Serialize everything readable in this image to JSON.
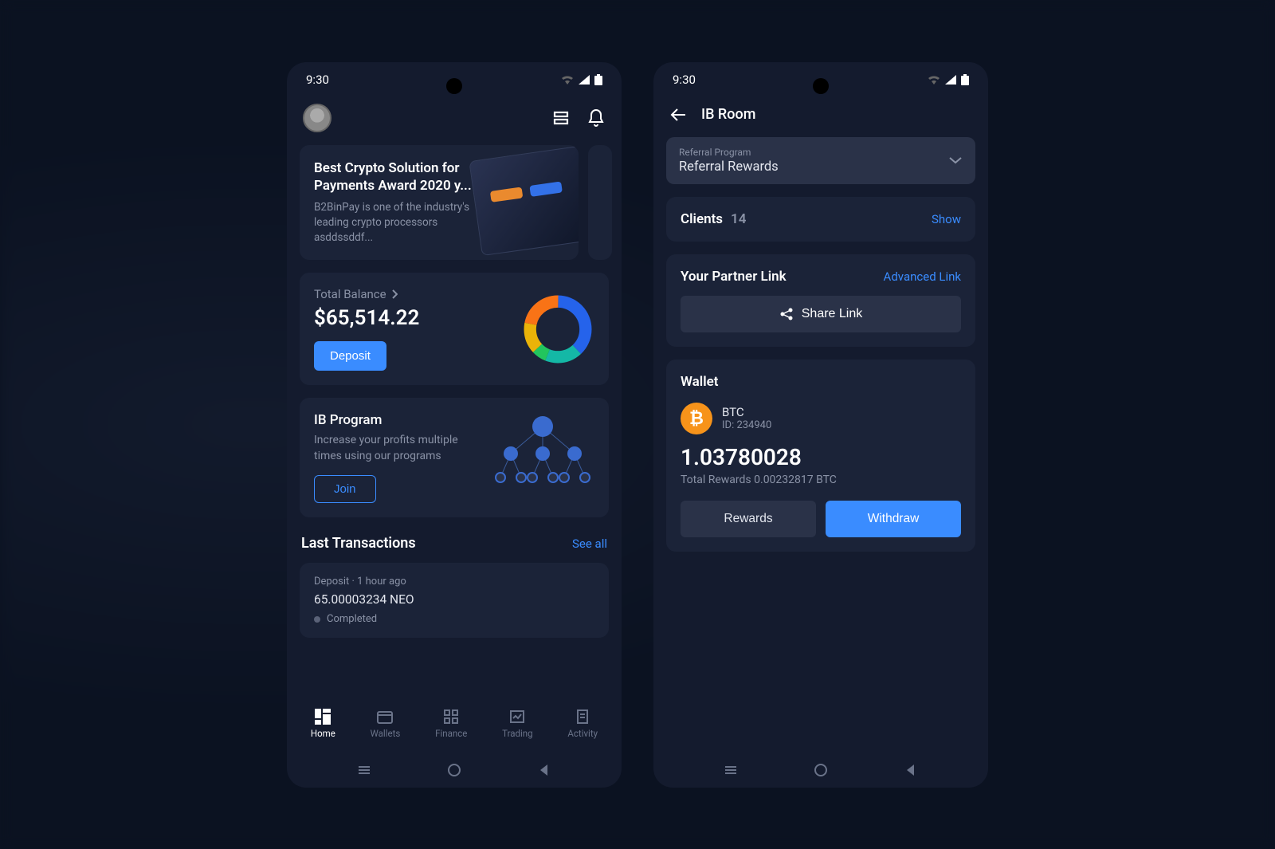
{
  "status_time": "9:30",
  "phone1": {
    "news": {
      "title": "Best Crypto Solution for Payments Award 2020 y...",
      "desc": "B2BinPay is one of the industry's leading crypto processors asddssddf..."
    },
    "balance": {
      "label": "Total Balance",
      "amount": "$65,514.22",
      "deposit_btn": "Deposit"
    },
    "ib": {
      "title": "IB Program",
      "desc": "Increase your profits multiple times using our programs",
      "join_btn": "Join"
    },
    "transactions": {
      "title": "Last Transactions",
      "see_all": "See all",
      "items": [
        {
          "meta": "Deposit · 1 hour ago",
          "amount": "65.00003234 NEO",
          "status": "Completed"
        }
      ]
    },
    "nav": [
      "Home",
      "Wallets",
      "Finance",
      "Trading",
      "Activity"
    ]
  },
  "phone2": {
    "title": "IB Room",
    "dropdown": {
      "label": "Referral Program",
      "value": "Referral Rewards"
    },
    "clients": {
      "label": "Clients",
      "count": "14",
      "show": "Show"
    },
    "partner": {
      "title": "Your Partner Link",
      "advanced": "Advanced Link",
      "share_btn": "Share Link"
    },
    "wallet": {
      "title": "Wallet",
      "coin": "BTC",
      "coin_id": "ID: 234940",
      "balance": "1.03780028",
      "rewards": "Total Rewards 0.00232817 BTC",
      "rewards_btn": "Rewards",
      "withdraw_btn": "Withdraw"
    }
  },
  "chart_data": {
    "type": "pie",
    "title": "Total Balance breakdown (donut, unlabeled)",
    "series": [
      {
        "name": "segment-blue",
        "value": 38,
        "color": "#2563eb"
      },
      {
        "name": "segment-teal",
        "value": 18,
        "color": "#14b8a6"
      },
      {
        "name": "segment-green",
        "value": 7,
        "color": "#22c55e"
      },
      {
        "name": "segment-yellow",
        "value": 15,
        "color": "#eab308"
      },
      {
        "name": "segment-orange",
        "value": 22,
        "color": "#f97316"
      }
    ]
  }
}
